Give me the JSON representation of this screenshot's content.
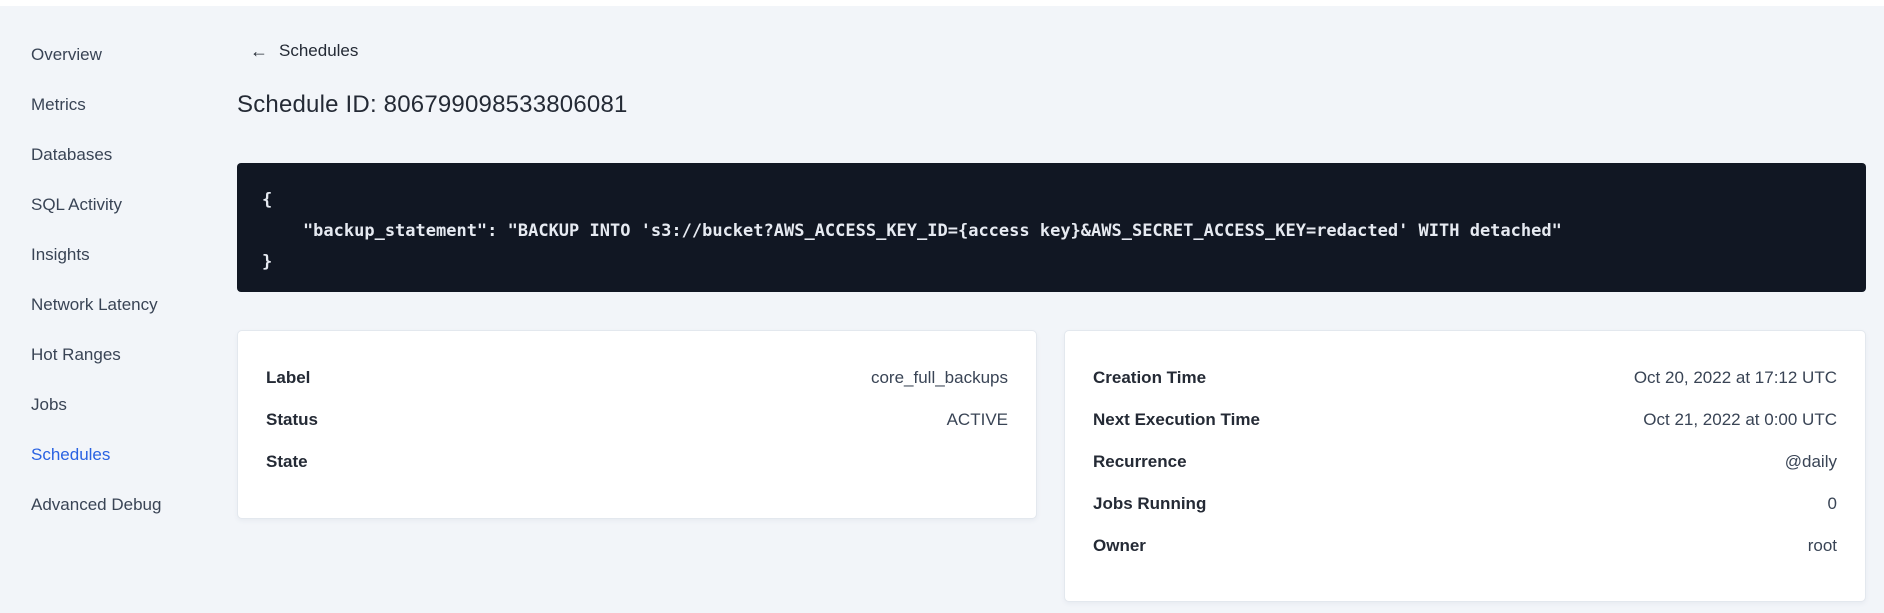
{
  "sidebar": {
    "items": [
      {
        "label": "Overview",
        "active": false
      },
      {
        "label": "Metrics",
        "active": false
      },
      {
        "label": "Databases",
        "active": false
      },
      {
        "label": "SQL Activity",
        "active": false
      },
      {
        "label": "Insights",
        "active": false
      },
      {
        "label": "Network Latency",
        "active": false
      },
      {
        "label": "Hot Ranges",
        "active": false
      },
      {
        "label": "Jobs",
        "active": false
      },
      {
        "label": "Schedules",
        "active": true
      },
      {
        "label": "Advanced Debug",
        "active": false
      }
    ]
  },
  "header": {
    "back_icon": "←",
    "back_label": "Schedules",
    "title": "Schedule ID: 806799098533806081"
  },
  "code": {
    "lines": [
      "{",
      "    \"backup_statement\": \"BACKUP INTO 's3://bucket?AWS_ACCESS_KEY_ID={access key}&AWS_SECRET_ACCESS_KEY=redacted' WITH detached\"",
      "}"
    ]
  },
  "details_card": {
    "rows": [
      {
        "label": "Label",
        "value": "core_full_backups"
      },
      {
        "label": "Status",
        "value": "ACTIVE"
      },
      {
        "label": "State",
        "value": ""
      }
    ]
  },
  "schedule_card": {
    "rows": [
      {
        "label": "Creation Time",
        "value": "Oct 20, 2022 at 17:12 UTC"
      },
      {
        "label": "Next Execution Time",
        "value": "Oct 21, 2022 at 0:00 UTC"
      },
      {
        "label": "Recurrence",
        "value": "@daily"
      },
      {
        "label": "Jobs Running",
        "value": "0"
      },
      {
        "label": "Owner",
        "value": "root"
      }
    ]
  },
  "colors": {
    "accent_blue": "#2962e2",
    "code_bg": "#111723",
    "page_bg": "#f2f5f9"
  }
}
